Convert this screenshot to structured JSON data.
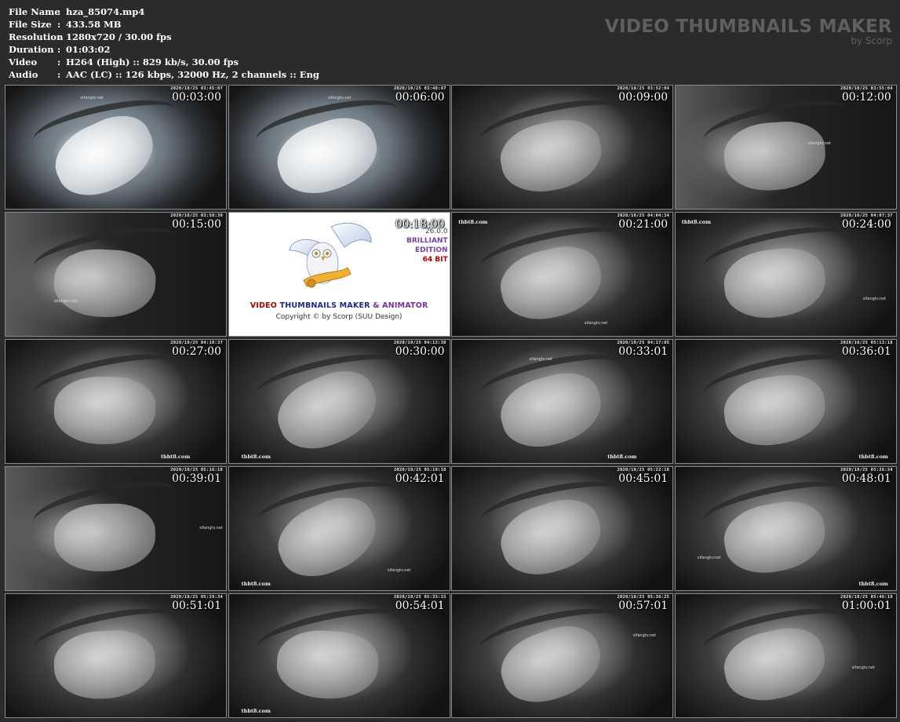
{
  "info": {
    "rows": [
      {
        "label": "File Name",
        "value": "hza_85074.mp4"
      },
      {
        "label": "File Size",
        "value": "433.58 MB"
      },
      {
        "label": "Resolution",
        "value": "1280x720 / 30.00 fps"
      },
      {
        "label": "Duration",
        "value": "01:03:02"
      },
      {
        "label": "Video",
        "value": "H264 (High) :: 829 kb/s, 30.00 fps"
      },
      {
        "label": "Audio",
        "value": "AAC (LC) :: 126 kbps, 32000 Hz, 2 channels :: Eng"
      }
    ],
    "colon": ":"
  },
  "brand": {
    "title": "VIDEO THUMBNAILS MAKER",
    "subtitle": "by Scorp"
  },
  "promo": {
    "version": "26.0.0",
    "edition_1": "BRILLIANT",
    "edition_2": "EDITION",
    "bits": "64 BIT",
    "app_1": "VIDEO",
    "app_2": "THUMBNAILS MAKER",
    "app_3": "& ANIMATOR",
    "copyright": "Copyright © by Scorp (SUU Design)"
  },
  "thumbs": [
    {
      "time": "00:03:00",
      "stamp": "2020/10/25 03:45:07",
      "style": "color",
      "wm": "sifangtv.net",
      "site": ""
    },
    {
      "time": "00:06:00",
      "stamp": "2020/10/25 03:48:47",
      "style": "color",
      "wm": "sifangtv.net",
      "site": ""
    },
    {
      "time": "00:09:00",
      "stamp": "2020/10/25 03:52:04",
      "style": "gray",
      "wm": "",
      "site": ""
    },
    {
      "time": "00:12:00",
      "stamp": "2020/10/25 03:55:04",
      "style": "dark",
      "wm": "sifangtv.net",
      "site": ""
    },
    {
      "time": "00:15:00",
      "stamp": "2020/10/25 03:58:30",
      "style": "dark",
      "wm": "sifangtv.net",
      "site": ""
    },
    {
      "time": "00:18:00",
      "stamp": "",
      "style": "promo",
      "wm": "",
      "site": ""
    },
    {
      "time": "00:21:00",
      "stamp": "2020/10/25 04:04:34",
      "style": "gray",
      "wm": "sifangtv.net",
      "site": "thbt8.com"
    },
    {
      "time": "00:24:00",
      "stamp": "2020/10/25 04:07:37",
      "style": "gray",
      "wm": "sifangtv.net",
      "site": "thbt8.com"
    },
    {
      "time": "00:27:00",
      "stamp": "2020/10/25 04:10:37",
      "style": "gray",
      "wm": "",
      "site": "thbt8.com"
    },
    {
      "time": "00:30:00",
      "stamp": "2020/10/25 04:13:38",
      "style": "gray",
      "wm": "",
      "site": "thbt8.com"
    },
    {
      "time": "00:33:01",
      "stamp": "2020/10/25 04:17:05",
      "style": "gray",
      "wm": "sifangtv.net",
      "site": "thbt8.com"
    },
    {
      "time": "00:36:01",
      "stamp": "2020/10/25 05:13:18",
      "style": "gray",
      "wm": "",
      "site": "thbt8.com"
    },
    {
      "time": "00:39:01",
      "stamp": "2020/10/25 05:16:18",
      "style": "dark",
      "wm": "sifangtv.net",
      "site": ""
    },
    {
      "time": "00:42:01",
      "stamp": "2020/10/25 05:19:18",
      "style": "gray",
      "wm": "sifangtv.net",
      "site": "thbt8.com"
    },
    {
      "time": "00:45:01",
      "stamp": "2020/10/25 05:22:18",
      "style": "gray",
      "wm": "",
      "site": ""
    },
    {
      "time": "00:48:01",
      "stamp": "2020/10/25 05:26:34",
      "style": "gray",
      "wm": "sifangtv.net",
      "site": "thbt8.com"
    },
    {
      "time": "00:51:01",
      "stamp": "2020/10/25 05:29:34",
      "style": "gray",
      "wm": "",
      "site": ""
    },
    {
      "time": "00:54:01",
      "stamp": "2020/10/25 05:33:15",
      "style": "gray",
      "wm": "",
      "site": "thbt8.com"
    },
    {
      "time": "00:57:01",
      "stamp": "2020/10/25 05:36:25",
      "style": "gray",
      "wm": "sifangtv.net",
      "site": ""
    },
    {
      "time": "01:00:01",
      "stamp": "2020/10/25 05:46:19",
      "style": "gray",
      "wm": "sifangtv.net",
      "site": ""
    }
  ]
}
